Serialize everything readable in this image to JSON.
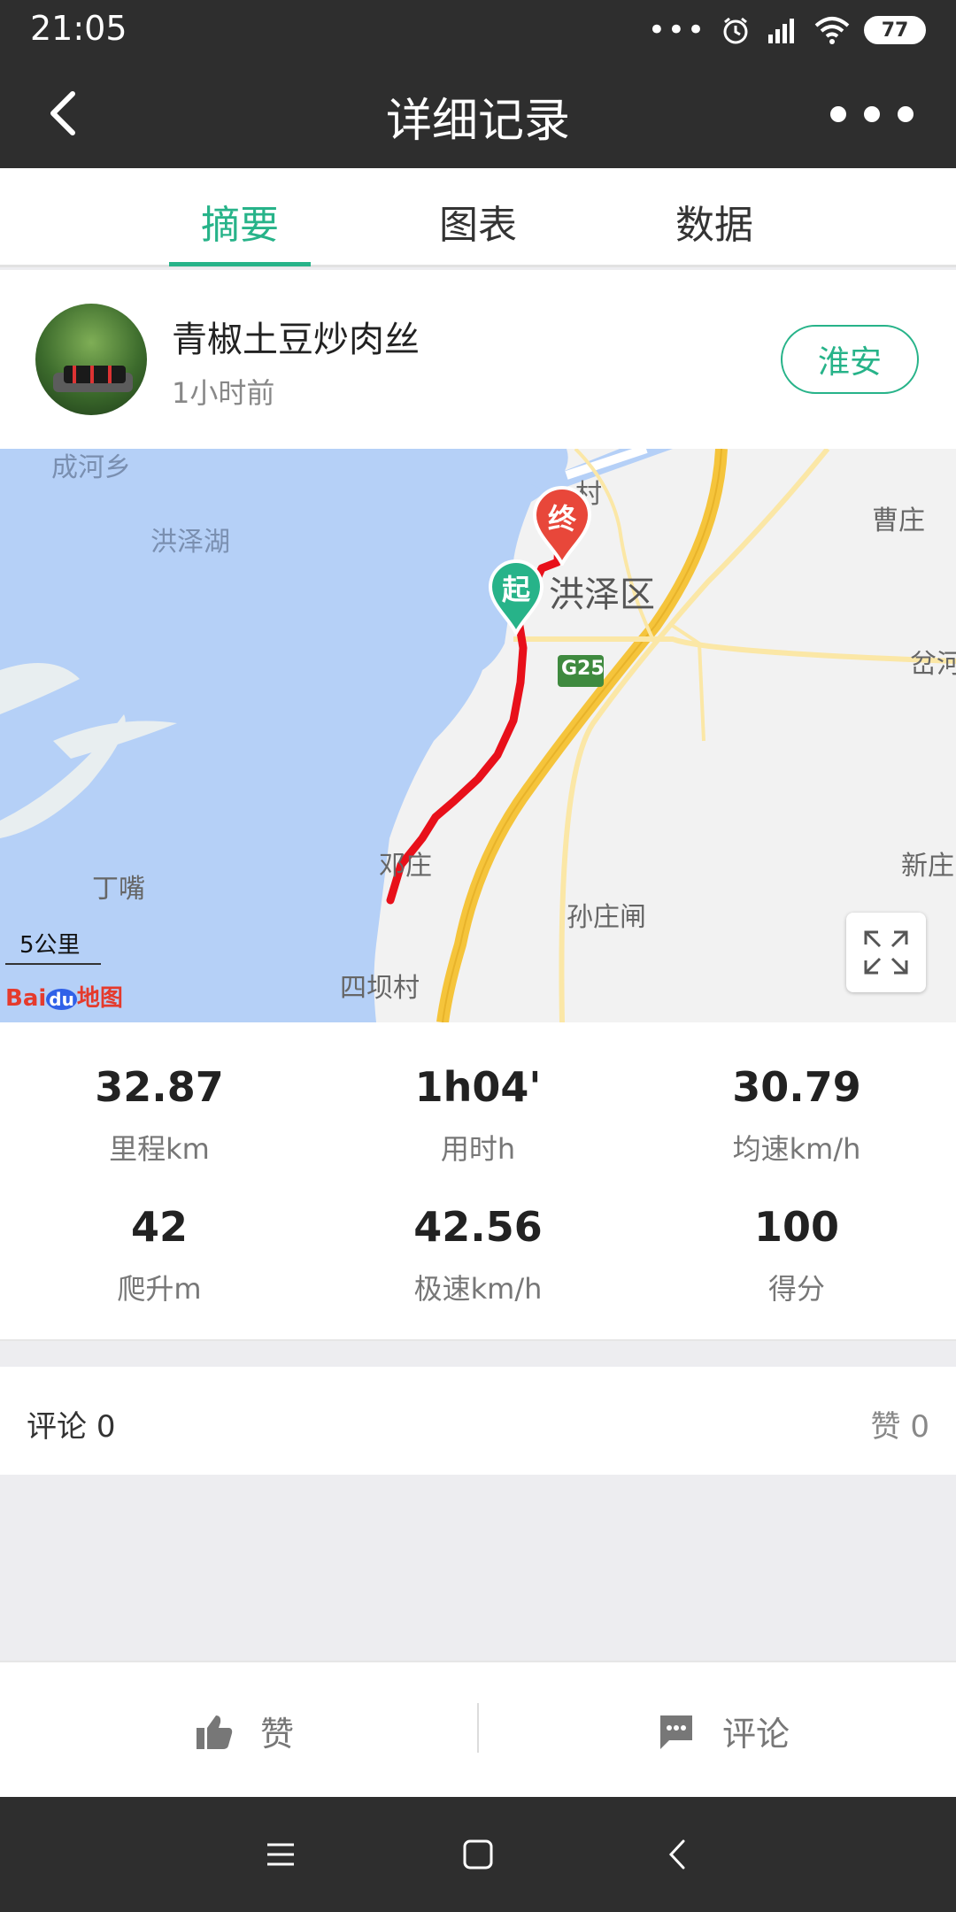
{
  "status_bar": {
    "time": "21:05",
    "dots": "•••",
    "battery": "77"
  },
  "nav": {
    "title": "详细记录"
  },
  "tabs": [
    {
      "label": "摘要",
      "active": true
    },
    {
      "label": "图表",
      "active": false
    },
    {
      "label": "数据",
      "active": false
    }
  ],
  "user": {
    "name": "青椒土豆炒肉丝",
    "time_ago": "1小时前",
    "city": "淮安"
  },
  "map": {
    "labels": {
      "chenghexiang": "成河乡",
      "hongzehu": "洪泽湖",
      "caozhuang": "曹庄",
      "hongzequ": "洪泽区",
      "cun": "村",
      "chahe": "岔河",
      "g25": "G25",
      "dengzhuang": "邓庄",
      "dingzui": "丁嘴",
      "xinzhuang": "新庄",
      "sunzhuangzha": "孙庄闸",
      "sibacun": "四坝村"
    },
    "start_marker": "起",
    "end_marker": "终",
    "scale": "5公里",
    "logo_bai": "Bai",
    "logo_du": "du",
    "logo_map": "地图",
    "colors": {
      "water": "#b5d0f7",
      "route": "#e8101a",
      "highway": "#f5c43b",
      "start": "#27b389",
      "end": "#e8473a"
    }
  },
  "stats": [
    {
      "value": "32.87",
      "label": "里程km"
    },
    {
      "value": "1h04'",
      "label": "用时h"
    },
    {
      "value": "30.79",
      "label": "均速km/h"
    },
    {
      "value": "42",
      "label": "爬升m"
    },
    {
      "value": "42.56",
      "label": "极速km/h"
    },
    {
      "value": "100",
      "label": "得分"
    }
  ],
  "comments": {
    "comment_label": "评论",
    "comment_count": "0",
    "like_label": "赞",
    "like_count": "0"
  },
  "actions": {
    "like": "赞",
    "comment": "评论"
  },
  "accent_color": "#27b389"
}
